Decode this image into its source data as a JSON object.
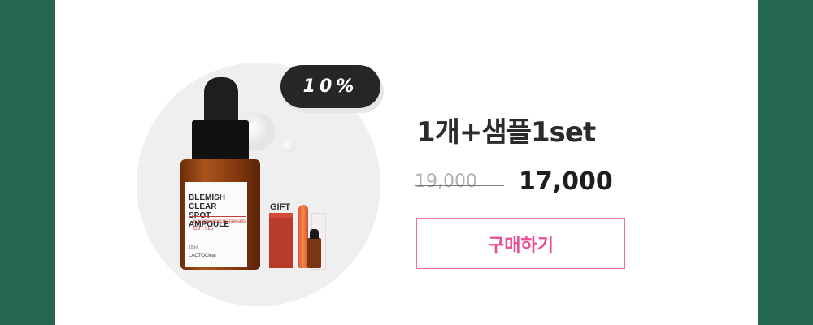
{
  "badge": {
    "discount": "10%"
  },
  "bottle": {
    "title_line1": "BLEMISH CLEAR",
    "title_line2": "SPOT AMPOULE",
    "subtitle": "E.Enterococcus faecalis",
    "code": "CBT SL5",
    "volume": "10ml",
    "brand": "LACTOClear"
  },
  "gift": {
    "label": "GIFT"
  },
  "product": {
    "title": "1개+샘플1set",
    "original_price": "19,000",
    "sale_price": "17,000",
    "buy_label": "구매하기"
  },
  "colors": {
    "frame": "#246752",
    "accent": "#ea4e96",
    "badge": "#262626"
  }
}
